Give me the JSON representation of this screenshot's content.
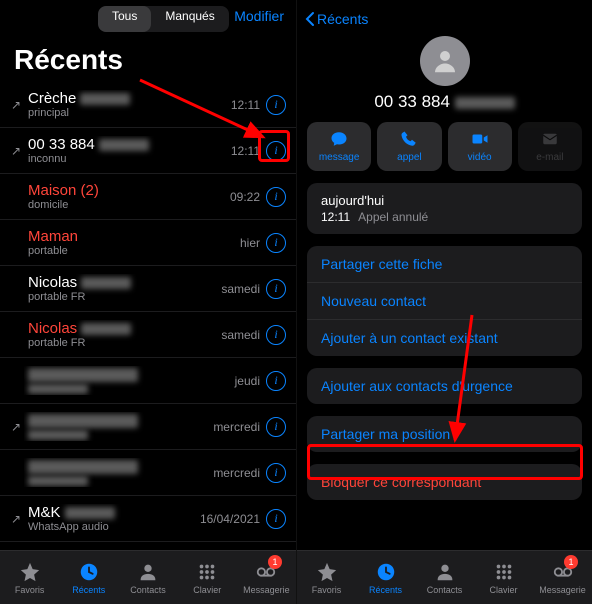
{
  "left": {
    "segmented": {
      "all": "Tous",
      "missed": "Manqués"
    },
    "edit": "Modifier",
    "title": "Récents",
    "calls": [
      {
        "name": "Crèche",
        "sub": "principal",
        "time": "12:11",
        "missed": false,
        "outgoing": true,
        "redactedTail": true
      },
      {
        "name": "00 33 884",
        "sub": "inconnu",
        "time": "12:11",
        "missed": false,
        "outgoing": true,
        "redactedTail": true
      },
      {
        "name": "Maison (2)",
        "sub": "domicile",
        "time": "09:22",
        "missed": true,
        "outgoing": false
      },
      {
        "name": "Maman",
        "sub": "portable",
        "time": "hier",
        "missed": true,
        "outgoing": false
      },
      {
        "name": "Nicolas",
        "sub": "portable FR",
        "time": "samedi",
        "missed": false,
        "outgoing": false,
        "redactedTail": true
      },
      {
        "name": "Nicolas",
        "sub": "portable FR",
        "time": "samedi",
        "missed": true,
        "outgoing": false,
        "redactedTail": true
      },
      {
        "name": "",
        "sub": "",
        "time": "jeudi",
        "missed": false,
        "outgoing": false,
        "redactedFull": true
      },
      {
        "name": "",
        "sub": "",
        "time": "mercredi",
        "missed": false,
        "outgoing": true,
        "redactedFull": true
      },
      {
        "name": "",
        "sub": "",
        "time": "mercredi",
        "missed": true,
        "outgoing": false,
        "redactedFull": true
      },
      {
        "name": "M&K",
        "sub": "WhatsApp audio",
        "time": "16/04/2021",
        "missed": false,
        "outgoing": true,
        "redactedTail": true
      }
    ],
    "tabs": {
      "favorites": "Favoris",
      "recents": "Récents",
      "contacts": "Contacts",
      "keypad": "Clavier",
      "voicemail": "Messagerie",
      "badge": "1"
    }
  },
  "right": {
    "back": "Récents",
    "number": "00 33 884",
    "actions": {
      "message": "message",
      "call": "appel",
      "video": "vidéo",
      "mail": "e-mail"
    },
    "history": {
      "day": "aujourd'hui",
      "time": "12:11",
      "event": "Appel annulé"
    },
    "share": "Partager cette fiche",
    "newContact": "Nouveau contact",
    "addExisting": "Ajouter à un contact existant",
    "emergency": "Ajouter aux contacts d'urgence",
    "location": "Partager ma position",
    "block": "Bloquer ce correspondant"
  }
}
